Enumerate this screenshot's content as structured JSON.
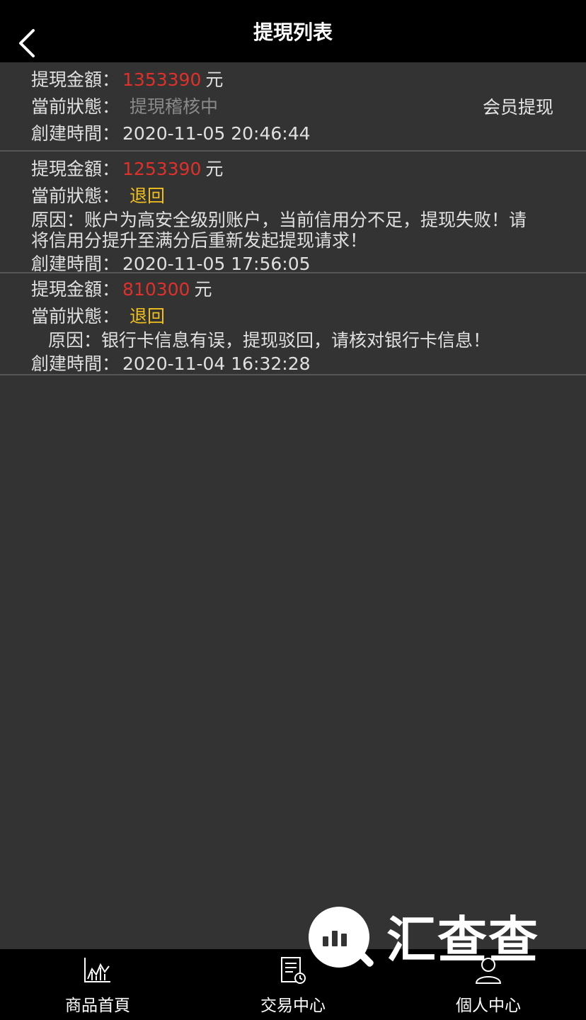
{
  "header": {
    "title": "提現列表",
    "back_icon": "chevron-left-icon"
  },
  "records": [
    {
      "amount_label": "提現金額：",
      "amount": "1353390",
      "unit": "元",
      "status_label": "當前狀態：",
      "status": "提現稽核中",
      "side_tag": "会员提现",
      "created_label": "創建時間：",
      "created": "2020-11-05 20:46:44"
    },
    {
      "amount_label": "提現金額：",
      "amount": "1253390",
      "unit": "元",
      "status_label": "當前狀態：",
      "status": "退回",
      "reason": "原因：账户为高安全级别账户，当前信用分不足，提现失败！请将信用分提升至满分后重新发起提现请求！",
      "created_label": "創建時間：",
      "created": "2020-11-05 17:56:05"
    },
    {
      "amount_label": "提現金額：",
      "amount": "810300",
      "unit": "元",
      "status_label": "當前狀態：",
      "status": "退回",
      "reason": "原因：银行卡信息有误，提现驳回，请核对银行卡信息！",
      "created_label": "創建時間：",
      "created": "2020-11-04 16:32:28"
    }
  ],
  "tabbar": [
    {
      "label": "商品首頁",
      "icon": "chart-icon"
    },
    {
      "label": "交易中心",
      "icon": "document-clock-icon"
    },
    {
      "label": "個人中心",
      "icon": "user-icon"
    }
  ],
  "watermark": {
    "text": "汇查查"
  },
  "colors": {
    "background": "#333333",
    "bar": "#000000",
    "amount": "#e0302a",
    "status_pending": "#8a8a8a",
    "status_returned": "#f2c01e"
  }
}
